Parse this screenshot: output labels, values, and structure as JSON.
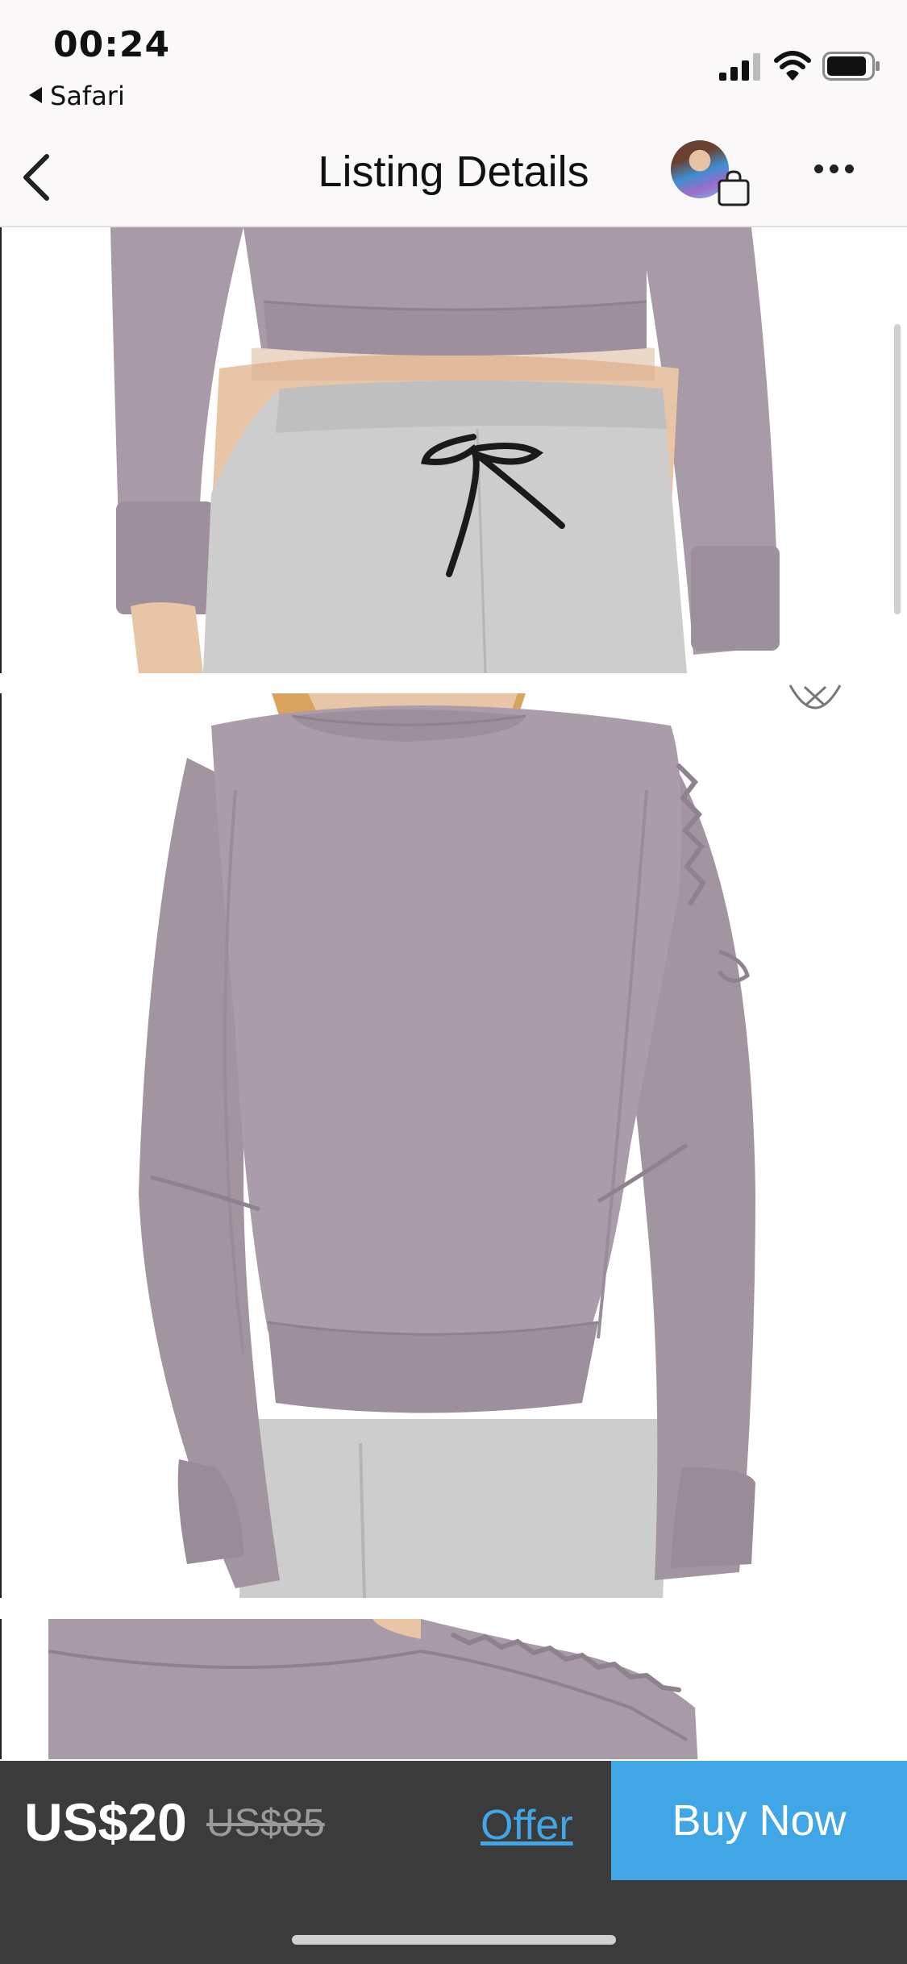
{
  "status_bar": {
    "time": "00:24",
    "back_app": "Safari",
    "icons": [
      "cellular-signal-icon",
      "wifi-icon",
      "battery-icon"
    ]
  },
  "nav": {
    "title": "Listing Details",
    "back_icon": "chevron-left-icon",
    "more_icon": "ellipsis-icon",
    "bag_icon": "shopping-bag-icon"
  },
  "gallery": {
    "photos": [
      "sweatshirt-front-detail",
      "sweatshirt-back",
      "sweatshirt-shoulder-detail"
    ],
    "zoom_icon": "chevron-up-icon"
  },
  "purchase_bar": {
    "price": "US$20",
    "original_price": "US$85",
    "offer_label": "Offer",
    "buy_label": "Buy Now"
  },
  "colors": {
    "accent": "#41a6e5",
    "bottom_bar": "#3b3b3b",
    "sweatshirt": "#a89aa6",
    "sweatpants": "#cdcdcd"
  }
}
